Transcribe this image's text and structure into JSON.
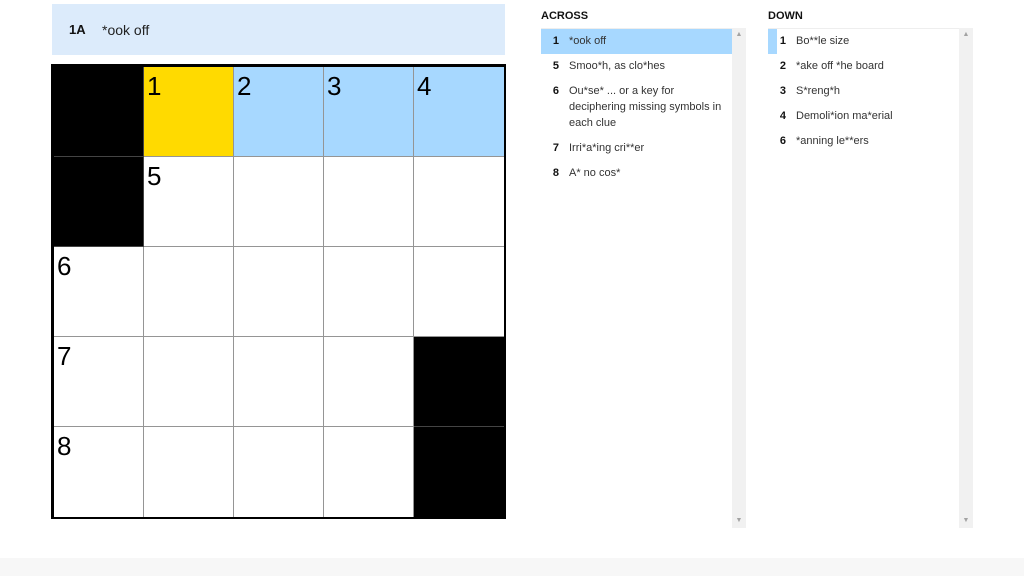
{
  "clue_bar": {
    "number": "1A",
    "text": "*ook off"
  },
  "grid": {
    "rows": 5,
    "cols": 5,
    "cells": [
      [
        {
          "black": true
        },
        {
          "n": "1",
          "state": "active"
        },
        {
          "n": "2",
          "state": "word"
        },
        {
          "n": "3",
          "state": "word"
        },
        {
          "n": "4",
          "state": "word"
        }
      ],
      [
        {
          "black": true
        },
        {
          "n": "5"
        },
        {},
        {},
        {}
      ],
      [
        {
          "n": "6"
        },
        {},
        {},
        {},
        {}
      ],
      [
        {
          "n": "7"
        },
        {},
        {},
        {},
        {
          "black": true
        }
      ],
      [
        {
          "n": "8"
        },
        {},
        {},
        {},
        {
          "black": true
        }
      ]
    ]
  },
  "across": {
    "title": "ACROSS",
    "clues": [
      {
        "num": "1",
        "text": "*ook off",
        "selected": true
      },
      {
        "num": "5",
        "text": "Smoo*h, as clo*hes"
      },
      {
        "num": "6",
        "text": "Ou*se* ... or a key for deciphering missing symbols in each clue"
      },
      {
        "num": "7",
        "text": "Irri*a*ing cri**er"
      },
      {
        "num": "8",
        "text": "A* no cos*"
      }
    ]
  },
  "down": {
    "title": "DOWN",
    "clues": [
      {
        "num": "1",
        "text": "Bo**le size",
        "crossing": true
      },
      {
        "num": "2",
        "text": "*ake off *he board"
      },
      {
        "num": "3",
        "text": "S*reng*h"
      },
      {
        "num": "4",
        "text": "Demoli*ion ma*erial"
      },
      {
        "num": "6",
        "text": "*anning le**ers"
      }
    ]
  },
  "icons": {
    "scroll_up": "▲",
    "scroll_down": "▼"
  }
}
